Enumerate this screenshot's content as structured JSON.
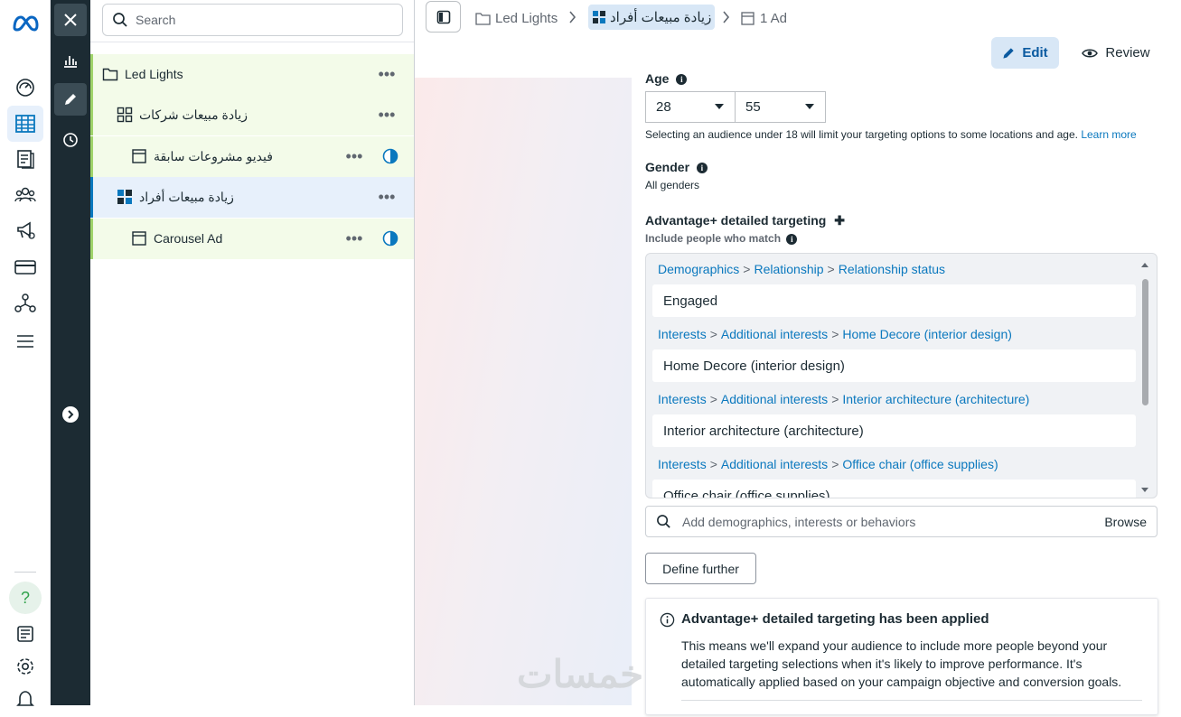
{
  "rail": {
    "items": [
      "meta-logo",
      "dashboard-icon",
      "campaigns-table-icon",
      "pages-icon",
      "audiences-icon",
      "ads-icon",
      "billing-icon",
      "business-icon",
      "menu-icon",
      "help-icon",
      "news-icon",
      "settings-icon",
      "notifications-icon"
    ],
    "help_label": "?"
  },
  "tree": {
    "search_placeholder": "Search",
    "rows": [
      {
        "label": "Led Lights",
        "level": "campaign"
      },
      {
        "label": "زيادة مبيعات شركات",
        "level": "adset"
      },
      {
        "label": "فيديو مشروعات سابقة",
        "level": "ad"
      },
      {
        "label": "زيادة مبيعات أفراد",
        "level": "adset"
      },
      {
        "label": "Carousel Ad",
        "level": "ad"
      }
    ],
    "more_label": "•••"
  },
  "breadcrumb": {
    "campaign": "Led Lights",
    "adset": "زيادة مبيعات أفراد",
    "ads": "1 Ad"
  },
  "toolbar": {
    "edit_label": "Edit",
    "review_label": "Review"
  },
  "form": {
    "age_label": "Age",
    "age_min": "28",
    "age_max": "55",
    "age_note": "Selecting an audience under 18 will limit your targeting options to some locations and age.",
    "learn_more": "Learn more",
    "gender_label": "Gender",
    "gender_value": "All genders",
    "detailed_label": "Advantage+ detailed targeting",
    "plus_label": "✚",
    "include_label": "Include people who match",
    "targets": [
      {
        "path": [
          "Demographics",
          "Relationship",
          "Relationship status"
        ],
        "item": "Engaged"
      },
      {
        "path": [
          "Interests",
          "Additional interests",
          "Home Decore (interior design)"
        ],
        "item": "Home Decore (interior design)"
      },
      {
        "path": [
          "Interests",
          "Additional interests",
          "Interior architecture (architecture)"
        ],
        "item": "Interior architecture (architecture)"
      },
      {
        "path": [
          "Interests",
          "Additional interests",
          "Office chair (office supplies)"
        ],
        "item": "Office chair (office supplies)"
      }
    ],
    "path_separator": ">",
    "add_placeholder": "Add demographics, interests or behaviors",
    "browse_label": "Browse",
    "define_further": "Define further",
    "notice_title": "Advantage+ detailed targeting has been applied",
    "notice_line1": "This means we'll expand your audience to include more people beyond your",
    "notice_line2": "detailed targeting selections when it's likely to improve performance. It's",
    "notice_line3": "automatically applied based on your campaign objective and conversion goals."
  },
  "watermark": "خمسات",
  "colors": {
    "accent": "#0a78be",
    "dark_rail": "#1c2b33",
    "selected_bg": "#e7f0fb",
    "green_bg": "#f3fbe9"
  }
}
